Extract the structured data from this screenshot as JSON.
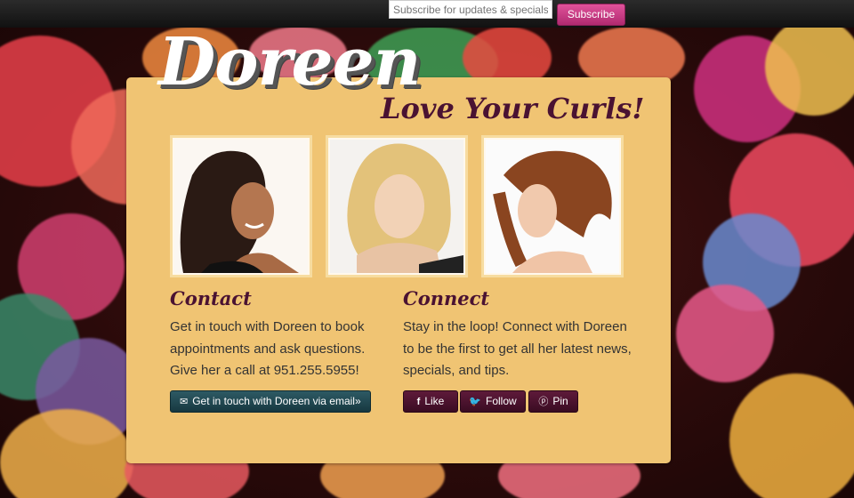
{
  "topbar": {
    "subscribe_placeholder": "Subscribe for updates & specials!",
    "subscribe_label": "Subscribe"
  },
  "brand": {
    "logo": "Doreen",
    "tagline": "Love Your Curls!"
  },
  "contact": {
    "heading": "Contact",
    "text": "Get in touch with Doreen to book appointments and ask questions. Give her a call at 951.255.5955!",
    "button_label": "Get in touch with Doreen via email»"
  },
  "connect": {
    "heading": "Connect",
    "text": "Stay in the loop! Connect with Doreen to be the first to get all her latest news, specials, and tips.",
    "buttons": [
      {
        "label": "Like",
        "icon": "facebook-icon"
      },
      {
        "label": "Follow",
        "icon": "twitter-icon"
      },
      {
        "label": "Pin",
        "icon": "pinterest-icon"
      }
    ]
  },
  "colors": {
    "card": "#f0c473",
    "accent": "#4a1232",
    "subscribe": "#c93b85"
  }
}
